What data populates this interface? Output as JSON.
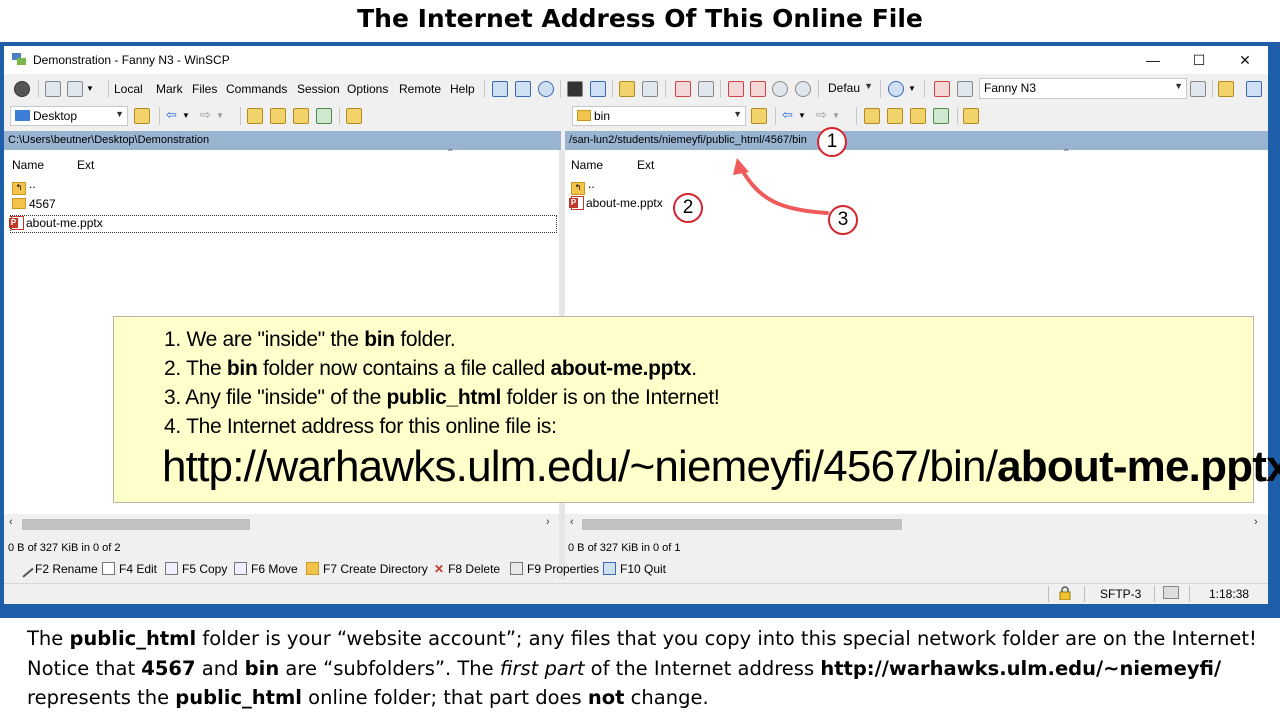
{
  "slide": {
    "title": "The Internet Address Of This Online File",
    "caption_lines": [
      [
        {
          "t": "The ",
          "b": false,
          "i": false
        },
        {
          "t": "public_html",
          "b": true,
          "i": false
        },
        {
          "t": " folder is your “website account”; any files that you copy into this special network folder are on the Internet!",
          "b": false,
          "i": false
        }
      ],
      [
        {
          "t": "Notice that ",
          "b": false,
          "i": false
        },
        {
          "t": "4567",
          "b": true,
          "i": false
        },
        {
          "t": " and ",
          "b": false,
          "i": false
        },
        {
          "t": "bin",
          "b": true,
          "i": false
        },
        {
          "t": " are “subfolders”. The ",
          "b": false,
          "i": false
        },
        {
          "t": "first part",
          "b": false,
          "i": true
        },
        {
          "t": " of the Internet address ",
          "b": false,
          "i": false
        },
        {
          "t": "http://warhawks.ulm.edu/~niemeyfi/",
          "b": true,
          "i": false
        }
      ],
      [
        {
          "t": "represents the ",
          "b": false,
          "i": false
        },
        {
          "t": "public_html",
          "b": true,
          "i": false
        },
        {
          "t": " online folder; that part does ",
          "b": false,
          "i": false
        },
        {
          "t": "not",
          "b": true,
          "i": false
        },
        {
          "t": " change.",
          "b": false,
          "i": false
        }
      ]
    ]
  },
  "window": {
    "title": "Demonstration - Fanny N3 - WinSCP",
    "controls": {
      "minimize": "—",
      "maximize": "☐",
      "close": "✕"
    }
  },
  "menu": {
    "items": [
      "Local",
      "Mark",
      "Files",
      "Commands",
      "Session",
      "Options",
      "Remote",
      "Help"
    ],
    "transfer_setting": "Defau",
    "session_name": "Fanny N3"
  },
  "local": {
    "location": "Desktop",
    "path": "C:\\Users\\beutner\\Desktop\\Demonstration",
    "columns": [
      "Name",
      "Ext"
    ],
    "files": [
      {
        "name": "..",
        "type": "up"
      },
      {
        "name": "4567",
        "type": "folder"
      },
      {
        "name": "about-me.pptx",
        "type": "pptx"
      }
    ],
    "status": "0 B of 327 KiB in 0 of 2"
  },
  "remote": {
    "location": "bin",
    "path": "/san-lun2/students/niemeyfi/public_html/4567/bin",
    "columns": [
      "Name",
      "Ext"
    ],
    "files": [
      {
        "name": "..",
        "type": "up"
      },
      {
        "name": "about-me.pptx",
        "type": "pptx"
      }
    ],
    "status": "0 B of 327 KiB in 0 of 1"
  },
  "function_keys": [
    "F2 Rename",
    "F4 Edit",
    "F5 Copy",
    "F6 Move",
    "F7 Create Directory",
    "F8 Delete",
    "F9 Properties",
    "F10 Quit"
  ],
  "statusbar": {
    "protocol": "SFTP-3",
    "time": "1:18:38"
  },
  "badges": [
    "1",
    "2",
    "3"
  ],
  "callout": {
    "items": [
      [
        {
          "t": "1. We are \"inside\" the ",
          "b": false
        },
        {
          "t": "bin",
          "b": true
        },
        {
          "t": " folder.",
          "b": false
        }
      ],
      [
        {
          "t": "2. The ",
          "b": false
        },
        {
          "t": "bin",
          "b": true
        },
        {
          "t": " folder now contains a file called  ",
          "b": false
        },
        {
          "t": "about-me.pptx",
          "b": true
        },
        {
          "t": ".",
          "b": false
        }
      ],
      [
        {
          "t": "3. Any file \"inside\" of the ",
          "b": false
        },
        {
          "t": "public_html",
          "b": true
        },
        {
          "t": " folder is on the Internet!",
          "b": false
        }
      ],
      [
        {
          "t": "4. The Internet address for this online file is:",
          "b": false
        }
      ]
    ],
    "url_prefix": "http://warhawks.ulm.edu/~niemeyfi/4567/bin/",
    "url_file": "about-me.pptx"
  },
  "colors": {
    "frame": "#1f5ea8",
    "pathbar": "#99b4d1",
    "callout_bg": "#ffffcc",
    "badge_border": "#d6222a",
    "arrow": "#f05a5a"
  }
}
